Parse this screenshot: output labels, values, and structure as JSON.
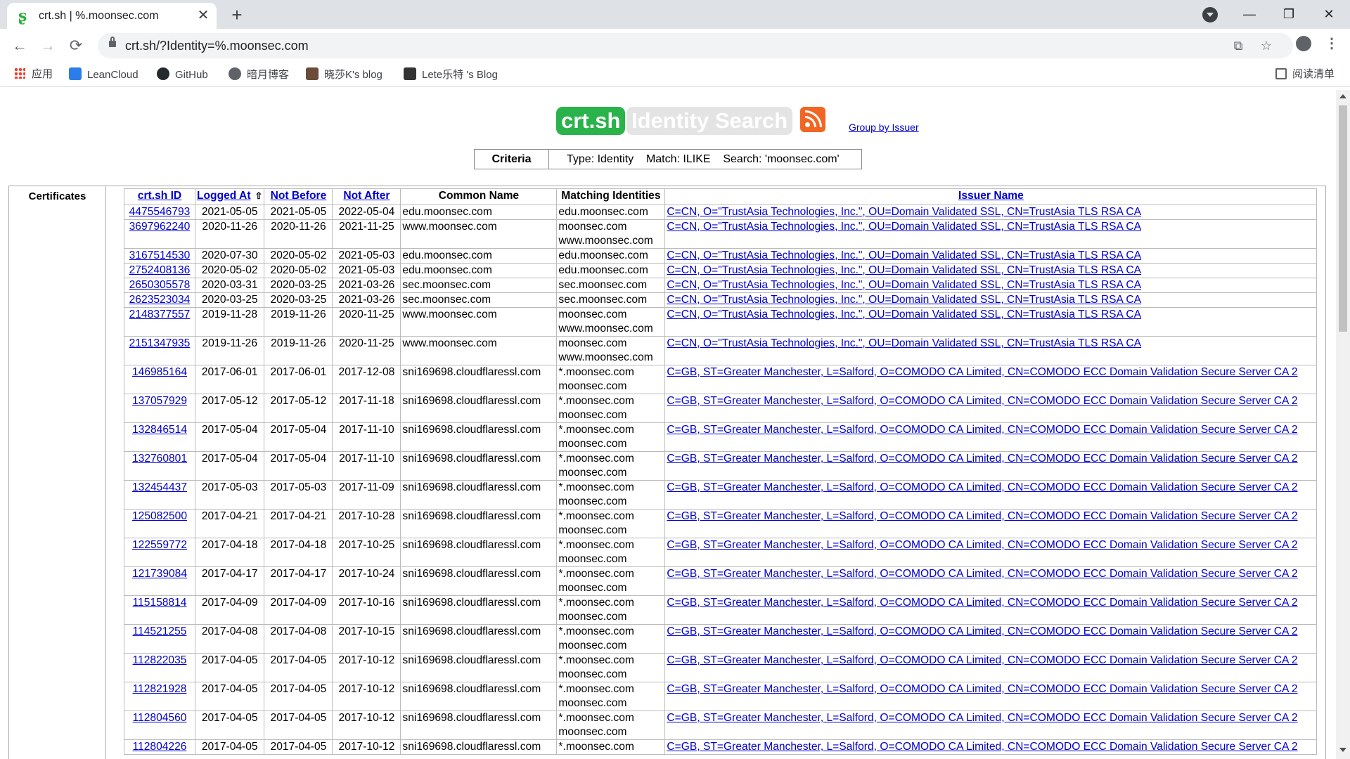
{
  "browser": {
    "tab_title": "crt.sh | %.moonsec.com",
    "tab_close": "✕",
    "new_tab": "+",
    "url": "crt.sh/?Identity=%.moonsec.com",
    "nav": {
      "back": "←",
      "forward": "→",
      "reload": "⟳"
    },
    "window": {
      "minimize": "—",
      "maximize": "❐",
      "close": "✕"
    },
    "omnibox_icons": {
      "translate": "⧉",
      "star": "☆"
    },
    "menu": "⋮"
  },
  "bookmarks": {
    "items": [
      {
        "label": "应用",
        "icon": "apps-grid-icon",
        "color": "#ea4335"
      },
      {
        "label": "LeanCloud",
        "icon": "leancloud-icon",
        "color": "#2b7de9"
      },
      {
        "label": "GitHub",
        "icon": "github-icon",
        "color": "#24292e"
      },
      {
        "label": "暗月博客",
        "icon": "globe-icon",
        "color": "#5f6368"
      },
      {
        "label": "晓莎K's blog",
        "icon": "avatar-icon",
        "color": "#6b4c3b"
      },
      {
        "label": "Lete乐特 's Blog",
        "icon": "avatar-icon",
        "color": "#333333"
      }
    ],
    "reading_list": "阅读清单"
  },
  "page": {
    "logo": "crt.sh",
    "title": "Identity Search",
    "group_link": "Group by Issuer",
    "criteria_label": "Criteria",
    "criteria_text": "Type: Identity    Match: ILIKE    Search: 'moonsec.com'",
    "certificates_label": "Certificates",
    "colors": {
      "logo_bg": "#2ab34a",
      "title_bg": "#e4e4e4",
      "rss": "#f26522",
      "link": "#0000cc"
    }
  },
  "table": {
    "headers": {
      "id": "crt.sh ID",
      "logged_at": "Logged At",
      "sort_arrow": "⇧",
      "not_before": "Not Before",
      "not_after": "Not After",
      "common_name": "Common Name",
      "matching": "Matching Identities",
      "issuer": "Issuer Name"
    },
    "rows": [
      [
        "4475546793",
        "2021-05-05",
        "2021-05-05",
        "2022-05-04",
        "edu.moonsec.com",
        "edu.moonsec.com",
        "",
        "C=CN, O=\"TrustAsia Technologies, Inc.\", OU=Domain Validated SSL, CN=TrustAsia TLS RSA CA"
      ],
      [
        "3697962240",
        "2020-11-26",
        "2020-11-26",
        "2021-11-25",
        "www.moonsec.com",
        "moonsec.com",
        "www.moonsec.com",
        "C=CN, O=\"TrustAsia Technologies, Inc.\", OU=Domain Validated SSL, CN=TrustAsia TLS RSA CA"
      ],
      [
        "3167514530",
        "2020-07-30",
        "2020-05-02",
        "2021-05-03",
        "edu.moonsec.com",
        "edu.moonsec.com",
        "",
        "C=CN, O=\"TrustAsia Technologies, Inc.\", OU=Domain Validated SSL, CN=TrustAsia TLS RSA CA"
      ],
      [
        "2752408136",
        "2020-05-02",
        "2020-05-02",
        "2021-05-03",
        "edu.moonsec.com",
        "edu.moonsec.com",
        "",
        "C=CN, O=\"TrustAsia Technologies, Inc.\", OU=Domain Validated SSL, CN=TrustAsia TLS RSA CA"
      ],
      [
        "2650305578",
        "2020-03-31",
        "2020-03-25",
        "2021-03-26",
        "sec.moonsec.com",
        "sec.moonsec.com",
        "",
        "C=CN, O=\"TrustAsia Technologies, Inc.\", OU=Domain Validated SSL, CN=TrustAsia TLS RSA CA"
      ],
      [
        "2623523034",
        "2020-03-25",
        "2020-03-25",
        "2021-03-26",
        "sec.moonsec.com",
        "sec.moonsec.com",
        "",
        "C=CN, O=\"TrustAsia Technologies, Inc.\", OU=Domain Validated SSL, CN=TrustAsia TLS RSA CA"
      ],
      [
        "2148377557",
        "2019-11-28",
        "2019-11-26",
        "2020-11-25",
        "www.moonsec.com",
        "moonsec.com",
        "www.moonsec.com",
        "C=CN, O=\"TrustAsia Technologies, Inc.\", OU=Domain Validated SSL, CN=TrustAsia TLS RSA CA"
      ],
      [
        "2151347935",
        "2019-11-26",
        "2019-11-26",
        "2020-11-25",
        "www.moonsec.com",
        "moonsec.com",
        "www.moonsec.com",
        "C=CN, O=\"TrustAsia Technologies, Inc.\", OU=Domain Validated SSL, CN=TrustAsia TLS RSA CA"
      ],
      [
        "146985164",
        "2017-06-01",
        "2017-06-01",
        "2017-12-08",
        "sni169698.cloudflaressl.com",
        "*.moonsec.com",
        "moonsec.com",
        "C=GB, ST=Greater Manchester, L=Salford, O=COMODO CA Limited, CN=COMODO ECC Domain Validation Secure Server CA 2"
      ],
      [
        "137057929",
        "2017-05-12",
        "2017-05-12",
        "2017-11-18",
        "sni169698.cloudflaressl.com",
        "*.moonsec.com",
        "moonsec.com",
        "C=GB, ST=Greater Manchester, L=Salford, O=COMODO CA Limited, CN=COMODO ECC Domain Validation Secure Server CA 2"
      ],
      [
        "132846514",
        "2017-05-04",
        "2017-05-04",
        "2017-11-10",
        "sni169698.cloudflaressl.com",
        "*.moonsec.com",
        "moonsec.com",
        "C=GB, ST=Greater Manchester, L=Salford, O=COMODO CA Limited, CN=COMODO ECC Domain Validation Secure Server CA 2"
      ],
      [
        "132760801",
        "2017-05-04",
        "2017-05-04",
        "2017-11-10",
        "sni169698.cloudflaressl.com",
        "*.moonsec.com",
        "moonsec.com",
        "C=GB, ST=Greater Manchester, L=Salford, O=COMODO CA Limited, CN=COMODO ECC Domain Validation Secure Server CA 2"
      ],
      [
        "132454437",
        "2017-05-03",
        "2017-05-03",
        "2017-11-09",
        "sni169698.cloudflaressl.com",
        "*.moonsec.com",
        "moonsec.com",
        "C=GB, ST=Greater Manchester, L=Salford, O=COMODO CA Limited, CN=COMODO ECC Domain Validation Secure Server CA 2"
      ],
      [
        "125082500",
        "2017-04-21",
        "2017-04-21",
        "2017-10-28",
        "sni169698.cloudflaressl.com",
        "*.moonsec.com",
        "moonsec.com",
        "C=GB, ST=Greater Manchester, L=Salford, O=COMODO CA Limited, CN=COMODO ECC Domain Validation Secure Server CA 2"
      ],
      [
        "122559772",
        "2017-04-18",
        "2017-04-18",
        "2017-10-25",
        "sni169698.cloudflaressl.com",
        "*.moonsec.com",
        "moonsec.com",
        "C=GB, ST=Greater Manchester, L=Salford, O=COMODO CA Limited, CN=COMODO ECC Domain Validation Secure Server CA 2"
      ],
      [
        "121739084",
        "2017-04-17",
        "2017-04-17",
        "2017-10-24",
        "sni169698.cloudflaressl.com",
        "*.moonsec.com",
        "moonsec.com",
        "C=GB, ST=Greater Manchester, L=Salford, O=COMODO CA Limited, CN=COMODO ECC Domain Validation Secure Server CA 2"
      ],
      [
        "115158814",
        "2017-04-09",
        "2017-04-09",
        "2017-10-16",
        "sni169698.cloudflaressl.com",
        "*.moonsec.com",
        "moonsec.com",
        "C=GB, ST=Greater Manchester, L=Salford, O=COMODO CA Limited, CN=COMODO ECC Domain Validation Secure Server CA 2"
      ],
      [
        "114521255",
        "2017-04-08",
        "2017-04-08",
        "2017-10-15",
        "sni169698.cloudflaressl.com",
        "*.moonsec.com",
        "moonsec.com",
        "C=GB, ST=Greater Manchester, L=Salford, O=COMODO CA Limited, CN=COMODO ECC Domain Validation Secure Server CA 2"
      ],
      [
        "112822035",
        "2017-04-05",
        "2017-04-05",
        "2017-10-12",
        "sni169698.cloudflaressl.com",
        "*.moonsec.com",
        "moonsec.com",
        "C=GB, ST=Greater Manchester, L=Salford, O=COMODO CA Limited, CN=COMODO ECC Domain Validation Secure Server CA 2"
      ],
      [
        "112821928",
        "2017-04-05",
        "2017-04-05",
        "2017-10-12",
        "sni169698.cloudflaressl.com",
        "*.moonsec.com",
        "moonsec.com",
        "C=GB, ST=Greater Manchester, L=Salford, O=COMODO CA Limited, CN=COMODO ECC Domain Validation Secure Server CA 2"
      ],
      [
        "112804560",
        "2017-04-05",
        "2017-04-05",
        "2017-10-12",
        "sni169698.cloudflaressl.com",
        "*.moonsec.com",
        "moonsec.com",
        "C=GB, ST=Greater Manchester, L=Salford, O=COMODO CA Limited, CN=COMODO ECC Domain Validation Secure Server CA 2"
      ],
      [
        "112804226",
        "2017-04-05",
        "2017-04-05",
        "2017-10-12",
        "sni169698.cloudflaressl.com",
        "*.moonsec.com",
        "",
        "C=GB, ST=Greater Manchester, L=Salford, O=COMODO CA Limited, CN=COMODO ECC Domain Validation Secure Server CA 2"
      ]
    ]
  }
}
